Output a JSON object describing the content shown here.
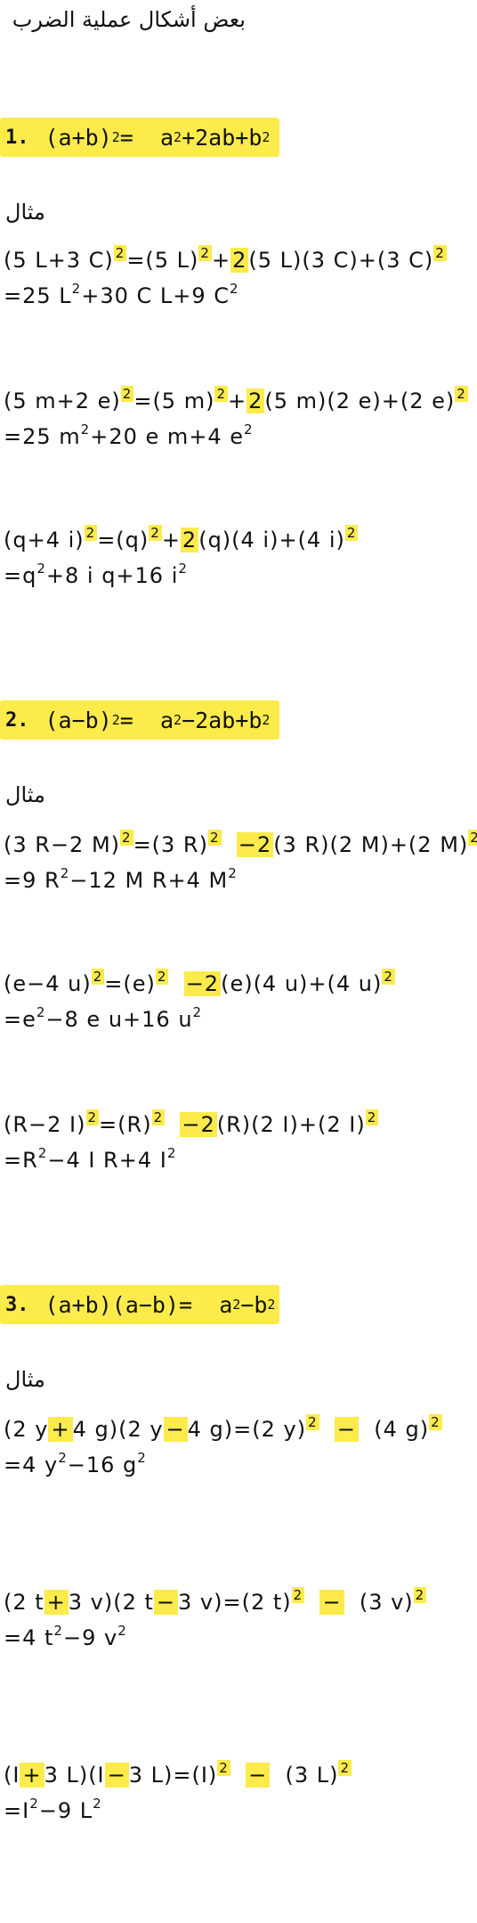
{
  "title": "بعض أشكال عملية الضرب",
  "mithal": "مثال",
  "formulas": {
    "f1": {
      "num": "1.",
      "lhs": "(a+b)",
      "exp": "2",
      "eq": "=",
      "rhs_a": "a",
      "rhs_e1": "2",
      "rhs_mid": "+2ab+b",
      "rhs_e2": "2"
    },
    "f2": {
      "num": "2.",
      "lhs": "(a−b)",
      "exp": "2",
      "eq": "=",
      "rhs_a": "a",
      "rhs_e1": "2",
      "rhs_mid": "−2ab+b",
      "rhs_e2": "2"
    },
    "f3": {
      "num": "3.",
      "lhs": "(a+b)(a−b)",
      "eq": "=",
      "rhs_a": "a",
      "rhs_e1": "2",
      "rhs_mid": "−b",
      "rhs_e2": "2"
    }
  },
  "examples": {
    "e1": {
      "l1": [
        "(5 L+3 C)",
        "2",
        "=(5 L)",
        "2",
        "+",
        "2",
        "(5 L)(3 C)+(3 C)",
        "2"
      ],
      "l2": [
        "=25 L",
        "2",
        "+30 C L+9 C",
        "2"
      ]
    },
    "e2": {
      "l1": [
        "(5 m+2 e)",
        "2",
        "=(5 m)",
        "2",
        "+",
        "2",
        "(5 m)(2 e)+(2 e)",
        "2"
      ],
      "l2": [
        "=25 m",
        "2",
        "+20 e m+4 e",
        "2"
      ]
    },
    "e3": {
      "l1": [
        "(q+4 i)",
        "2",
        "=(q)",
        "2",
        "+",
        "2",
        "(q)(4 i)+(4 i)",
        "2"
      ],
      "l2": [
        "=q",
        "2",
        "+8 i q+16 i",
        "2"
      ]
    },
    "e4": {
      "l1": [
        "(3 R−2 M)",
        "2",
        "=(3 R)",
        "2",
        "−2",
        "(3 R)(2 M)+(2 M)",
        "2"
      ],
      "l2": [
        "=9 R",
        "2",
        "−12 M R+4 M",
        "2"
      ]
    },
    "e5": {
      "l1": [
        "(e−4 u)",
        "2",
        "=(e)",
        "2",
        "−2",
        "(e)(4 u)+(4 u)",
        "2"
      ],
      "l2": [
        "=e",
        "2",
        "−8 e u+16 u",
        "2"
      ]
    },
    "e6": {
      "l1": [
        "(R−2 I)",
        "2",
        "=(R)",
        "2",
        "−2",
        "(R)(2 I)+(2 I)",
        "2"
      ],
      "l2": [
        "=R",
        "2",
        "−4 I R+4 I",
        "2"
      ]
    },
    "e7": {
      "l1": [
        "(2 y",
        "+",
        "4 g)(2 y",
        "−",
        "4 g)=(2 y)",
        "2",
        "−",
        "(4 g)",
        "2"
      ],
      "l2": [
        "=4 y",
        "2",
        "−16 g",
        "2"
      ]
    },
    "e8": {
      "l1": [
        "(2 t",
        "+",
        "3 v)(2 t",
        "−",
        "3 v)=(2 t)",
        "2",
        "−",
        "(3 v)",
        "2"
      ],
      "l2": [
        "=4 t",
        "2",
        "−9 v",
        "2"
      ]
    },
    "e9": {
      "l1": [
        "(I",
        "+",
        "3 L)(I",
        "−",
        "3 L)=(I)",
        "2",
        "−",
        "(3 L)",
        "2"
      ],
      "l2": [
        "=I",
        "2",
        "−9 L",
        "2"
      ]
    }
  }
}
